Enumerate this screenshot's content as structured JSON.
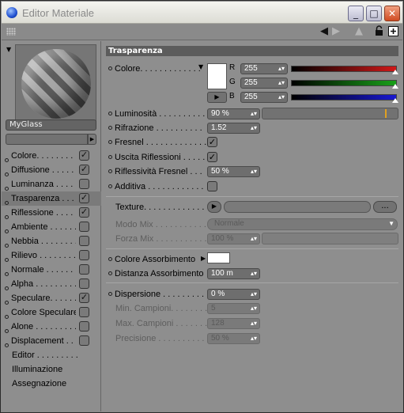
{
  "window": {
    "title": "Editor Materiale",
    "btn_min": "_",
    "btn_max": "□",
    "btn_close": "✕"
  },
  "toolbar": {
    "icons": [
      "grip-icon",
      "back-arrow-icon",
      "forward-arrow-icon",
      "up-arrow-icon",
      "lock-icon",
      "new-window-icon"
    ]
  },
  "material": {
    "name": "MyGlass"
  },
  "channels": [
    {
      "label": "Colore. . . . . . . . .",
      "checked": true
    },
    {
      "label": "Diffusione . . . . . . .",
      "checked": true
    },
    {
      "label": "Luminanza . . . . . .",
      "checked": false
    },
    {
      "label": "Trasparenza . . . .",
      "checked": true,
      "selected": true
    },
    {
      "label": "Riflessione . . . . . .",
      "checked": true
    },
    {
      "label": "Ambiente . . . . . . .",
      "checked": false
    },
    {
      "label": "Nebbia . . . . . . . . .",
      "checked": false
    },
    {
      "label": "Rilievo . . . . . . . . .",
      "checked": false
    },
    {
      "label": "Normale . . . . . . . .",
      "checked": false
    },
    {
      "label": "Alpha . . . . . . . . . .",
      "checked": false
    },
    {
      "label": "Speculare. . . . . . .",
      "checked": true
    },
    {
      "label": "Colore Speculare",
      "checked": false
    },
    {
      "label": "Alone . . . . . . . . . .",
      "checked": false
    },
    {
      "label": "Displacement . . .",
      "checked": false
    }
  ],
  "extra_items": [
    "Editor . . . . . . . . .",
    "Illuminazione",
    "Assegnazione"
  ],
  "panel": {
    "header": "Trasparenza",
    "colore_label": "Colore. . . . . . . . . . . . .",
    "r_label": "R",
    "g_label": "G",
    "b_label": "B",
    "r": "255",
    "g": "255",
    "b": "255",
    "luminosita_label": "Luminosità . . . . . . . . . .",
    "luminosita": "90 %",
    "rifrazione_label": "Rifrazione . . . . . . . . . .",
    "rifrazione": "1.52",
    "fresnel_label": "Fresnel . . . . . . . . . . . . .",
    "fresnel": true,
    "uscita_label": "Uscita Riflessioni . . . . .",
    "uscita": true,
    "riflessivita_label": "Riflessività Fresnel . . .",
    "riflessivita": "50 %",
    "additiva_label": "Additiva . . . . . . . . . . . .",
    "additiva": false,
    "texture_label": "Texture. . . . . . . . . . . . .",
    "texture_more": "...",
    "modomix_label": "Modo Mix . . . . . . . . . . .",
    "modomix": "Normale",
    "forzamix_label": "Forza Mix . . . . . . . . . . .",
    "forzamix": "100 %",
    "colore_ass_label": "Colore Assorbimento",
    "dist_ass_label": "Distanza Assorbimento",
    "dist_ass": "100 m",
    "dispersione_label": "Dispersione . . . . . . . . .",
    "dispersione": "0 %",
    "min_camp_label": "Min. Campioni. . . . . . . .",
    "min_camp": "5",
    "max_camp_label": "Max. Campioni . . . . . . .",
    "max_camp": "128",
    "precisione_label": "Precisione . . . . . . . . . .",
    "precisione": "50 %"
  },
  "colors": {
    "red": "#d01818",
    "green": "#18a018",
    "blue": "#1818d0",
    "accent": "#5c5c5c"
  }
}
